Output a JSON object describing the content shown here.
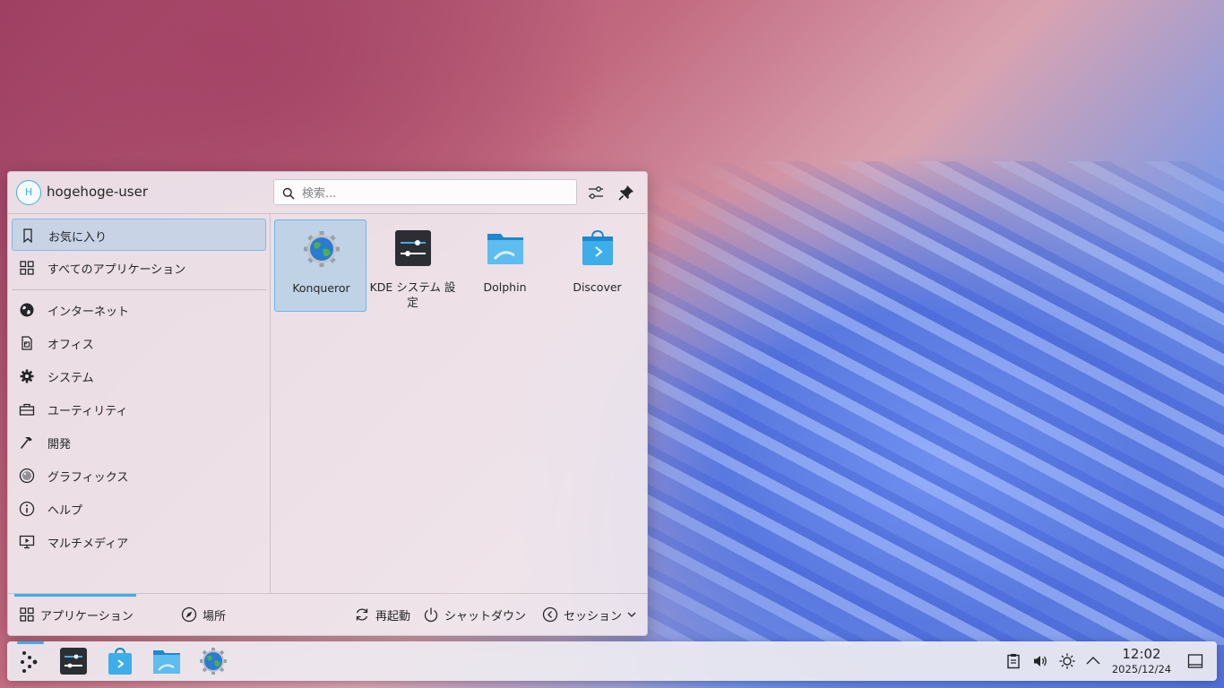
{
  "launcher": {
    "user": {
      "avatar_initial": "H",
      "name": "hogehoge-user"
    },
    "search": {
      "placeholder": "検索..."
    },
    "sidebar": {
      "items": [
        {
          "label": "お気に入り",
          "icon": "bookmark-icon",
          "active": true
        },
        {
          "label": "すべてのアプリケーション",
          "icon": "grid-icon"
        },
        {
          "label": "インターネット",
          "icon": "globe-icon"
        },
        {
          "label": "オフィス",
          "icon": "office-icon"
        },
        {
          "label": "システム",
          "icon": "gear-icon"
        },
        {
          "label": "ユーティリティ",
          "icon": "toolbox-icon"
        },
        {
          "label": "開発",
          "icon": "hammer-icon"
        },
        {
          "label": "グラフィックス",
          "icon": "palette-icon"
        },
        {
          "label": "ヘルプ",
          "icon": "info-icon"
        },
        {
          "label": "マルチメディア",
          "icon": "monitor-play-icon"
        }
      ]
    },
    "favorites": [
      {
        "label": "Konqueror",
        "icon": "konqueror-icon",
        "active": true
      },
      {
        "label": "KDE システム 設定",
        "icon": "system-settings-icon"
      },
      {
        "label": "Dolphin",
        "icon": "dolphin-folder-icon"
      },
      {
        "label": "Discover",
        "icon": "discover-bag-icon"
      }
    ],
    "footer": {
      "applications": "アプリケーション",
      "places": "場所",
      "restart": "再起動",
      "shutdown": "シャットダウン",
      "session": "セッション"
    }
  },
  "taskbar": {
    "apps": [
      "app-launcher-icon",
      "system-settings-icon",
      "discover-bag-icon",
      "dolphin-folder-icon",
      "konqueror-icon"
    ],
    "tray": [
      "clipboard-icon",
      "volume-icon",
      "brightness-icon",
      "chevron-up-icon"
    ],
    "clock": {
      "time": "12:02",
      "date": "2025/12/24"
    }
  },
  "colors": {
    "accent": "#3daee9",
    "panel_bg": "#eeecf1",
    "text": "#232629"
  }
}
